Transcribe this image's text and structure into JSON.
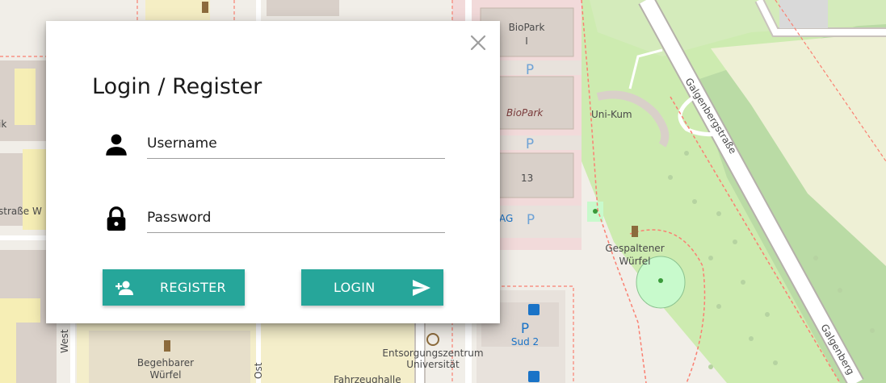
{
  "map": {
    "labels": {
      "biopark_i_line1": "BioPark",
      "biopark_i_line2": "I",
      "biopark": "BioPark",
      "uni_kum": "Uni-Kum",
      "number_13": "13",
      "ag": "AG",
      "gespaltener_line1": "Gespaltener",
      "gespaltener_line2": "Würfel",
      "galgenberg_1": "Galgenbergstraße",
      "galgenberg_2": "Galgenberg",
      "sud2": "Sud 2",
      "entsorgung_line1": "Entsorgungszentrum",
      "entsorgung_line2": "Universität",
      "begehbarer_line1": "Begehbarer",
      "begehbarer_line2": "Würfel",
      "west": "West",
      "ost": "Ost",
      "strasse_w": "straße W",
      "ik": "ik",
      "fahrzeughalle": "Fahrzeughalle",
      "parking": "P"
    },
    "colors": {
      "background": "#f1eee8",
      "building": "#d9d0c9",
      "grass": "#cdebb0",
      "park": "#c8facc",
      "road": "#ffffff",
      "footway": "#fa8072",
      "service": "#e8e2dc",
      "forest": "#add19e"
    }
  },
  "dialog": {
    "title": "Login / Register",
    "username": {
      "placeholder": "Username",
      "value": ""
    },
    "password": {
      "placeholder": "Password",
      "value": ""
    },
    "register_label": "REGISTER",
    "login_label": "LOGIN",
    "accent_color": "#26a69a",
    "icons": {
      "close": "close-icon",
      "user": "person-icon",
      "lock": "lock-icon",
      "register": "person-add-icon",
      "login": "send-icon"
    }
  }
}
